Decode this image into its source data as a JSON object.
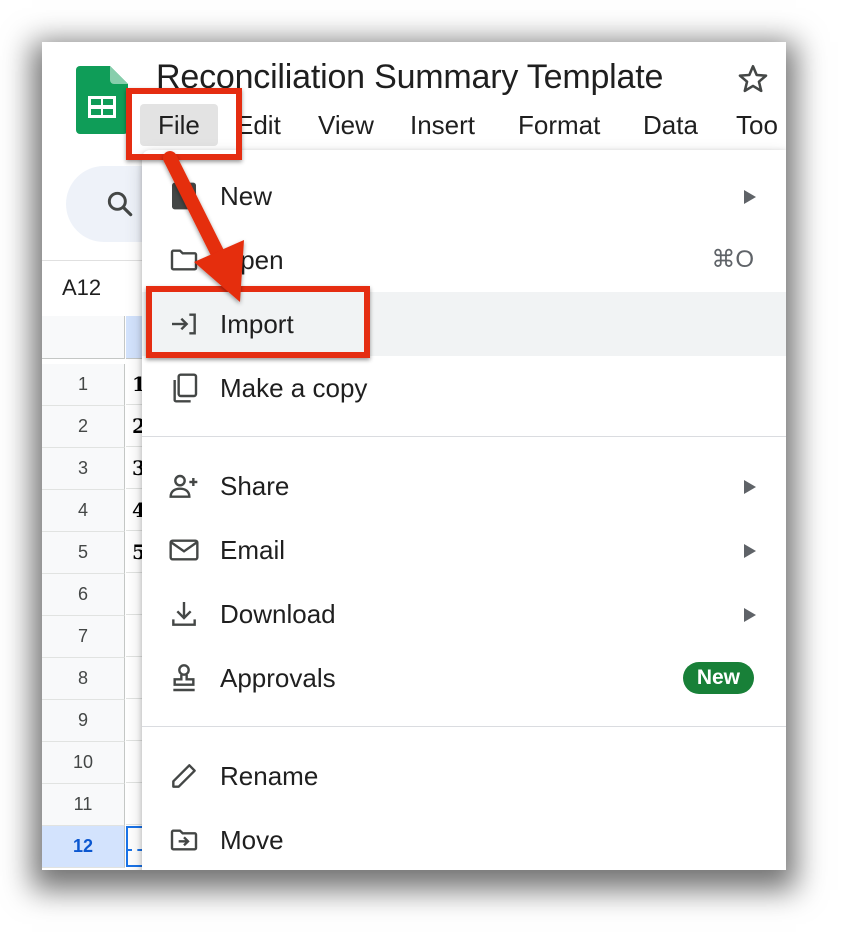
{
  "document": {
    "title": "Reconciliation Summary Template"
  },
  "menubar": {
    "items": [
      "File",
      "Edit",
      "View",
      "Insert",
      "Format",
      "Data",
      "Too"
    ]
  },
  "name_box": "A12",
  "grid": {
    "rows": [
      "1",
      "2",
      "3",
      "4",
      "5",
      "6",
      "7",
      "8",
      "9",
      "10",
      "11",
      "12"
    ],
    "cells": [
      "1",
      "2",
      "3",
      "4",
      "5",
      "",
      "",
      "",
      "",
      "",
      "",
      ""
    ],
    "selected_row": "12"
  },
  "file_menu": {
    "items": [
      {
        "label": "New",
        "icon": "new-icon",
        "submenu": true
      },
      {
        "label": "Open",
        "icon": "folder-icon",
        "shortcut": "⌘O"
      },
      {
        "label": "Import",
        "icon": "import-icon",
        "highlighted": true
      },
      {
        "label": "Make a copy",
        "icon": "copy-icon"
      },
      {
        "label": "Share",
        "icon": "person-add-icon",
        "submenu": true
      },
      {
        "label": "Email",
        "icon": "mail-icon",
        "submenu": true
      },
      {
        "label": "Download",
        "icon": "download-icon",
        "submenu": true
      },
      {
        "label": "Approvals",
        "icon": "approvals-icon",
        "badge": "New"
      },
      {
        "label": "Rename",
        "icon": "pencil-icon"
      },
      {
        "label": "Move",
        "icon": "move-folder-icon"
      }
    ]
  },
  "colors": {
    "annotation_red": "#e52d11",
    "badge_green": "#188038",
    "selection_blue": "#d3e3fd"
  }
}
